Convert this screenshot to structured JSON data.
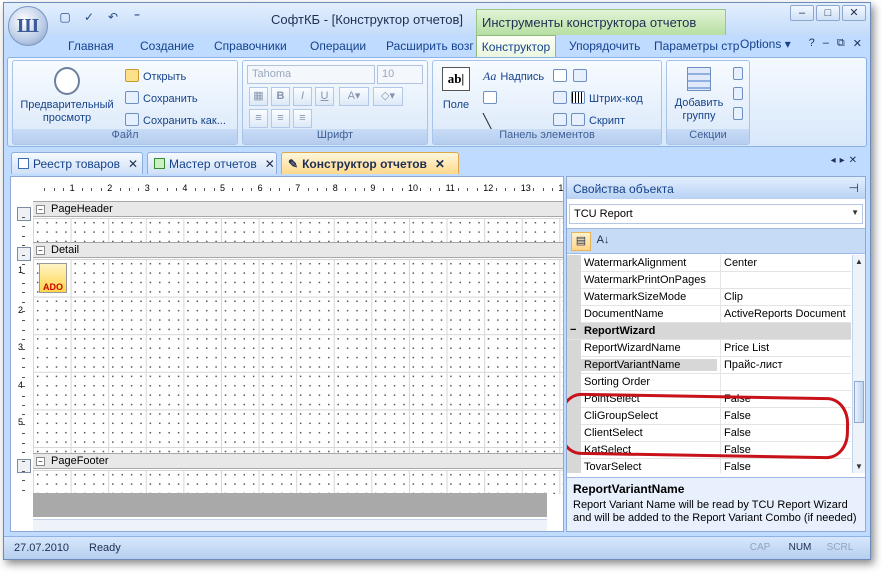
{
  "app": {
    "title": "СофтКБ - [Конструктор отчетов]",
    "context_title": "Инструменты конструктора отчетов"
  },
  "ribbon_tabs": [
    "Главная",
    "Создание",
    "Справочники",
    "Операции",
    "Расширить возг",
    "Конструктор",
    "Упорядочить",
    "Параметры стр"
  ],
  "active_tab": "Конструктор",
  "options_label": "Options",
  "groups": {
    "file": {
      "label": "Файл",
      "preview": "Предварительный просмотр",
      "open": "Открыть",
      "save": "Сохранить",
      "save_as": "Сохранить как..."
    },
    "font": {
      "label": "Шрифт",
      "font_name": "Tahoma",
      "font_size": "10",
      "bold": "B",
      "italic": "I",
      "underline": "U"
    },
    "elements": {
      "label": "Панель элементов",
      "field": "Поле",
      "label_tool": "Надпись",
      "barcode": "Штрих-код",
      "script": "Скрипт"
    },
    "sections": {
      "label": "Секции",
      "add_group": "Добавить группу"
    }
  },
  "doc_tabs": [
    "Реестр товаров",
    "Мастер отчетов",
    "Конструктор отчетов"
  ],
  "active_doc_tab": "Конструктор отчетов",
  "designer": {
    "ruler_numbers": [
      "1",
      "2",
      "3",
      "4",
      "5",
      "6",
      "7",
      "8",
      "9",
      "10",
      "11",
      "12",
      "13",
      "1"
    ],
    "vruler_numbers": [
      "1",
      "2",
      "3",
      "4",
      "5"
    ],
    "bands": [
      "PageHeader",
      "Detail",
      "PageFooter"
    ],
    "ado_label": "ADO"
  },
  "properties": {
    "header": "Свойства объекта",
    "object": "TCU Report",
    "rows": [
      {
        "name": "WatermarkAlignment",
        "value": "Center"
      },
      {
        "name": "WatermarkPrintOnPages",
        "value": ""
      },
      {
        "name": "WatermarkSizeMode",
        "value": "Clip"
      },
      {
        "name": "DocumentName",
        "value": "ActiveReports Document"
      },
      {
        "name": "ReportWizard",
        "value": "",
        "category": true
      },
      {
        "name": "ReportWizardName",
        "value": "Price List"
      },
      {
        "name": "ReportVariantName",
        "value": "Прайс-лист",
        "selected": true
      },
      {
        "name": "Sorting Order",
        "value": ""
      },
      {
        "name": "PointSelect",
        "value": "False"
      },
      {
        "name": "CliGroupSelect",
        "value": "False"
      },
      {
        "name": "ClientSelect",
        "value": "False"
      },
      {
        "name": "KatSelect",
        "value": "False"
      },
      {
        "name": "TovarSelect",
        "value": "False"
      }
    ],
    "desc_title": "ReportVariantName",
    "desc_text": "Report Variant Name will be read by TCU Report Wizard and will be added to the Report Variant Combo (if needed)"
  },
  "status": {
    "date": "27.07.2010",
    "state": "Ready",
    "indicators": [
      "CAP",
      "NUM",
      "SCRL"
    ]
  },
  "colors": {
    "highlight_ellipse": "#c81219",
    "context_tab": "#b7dfa2",
    "active_doc_tab": "#ffd98c"
  }
}
